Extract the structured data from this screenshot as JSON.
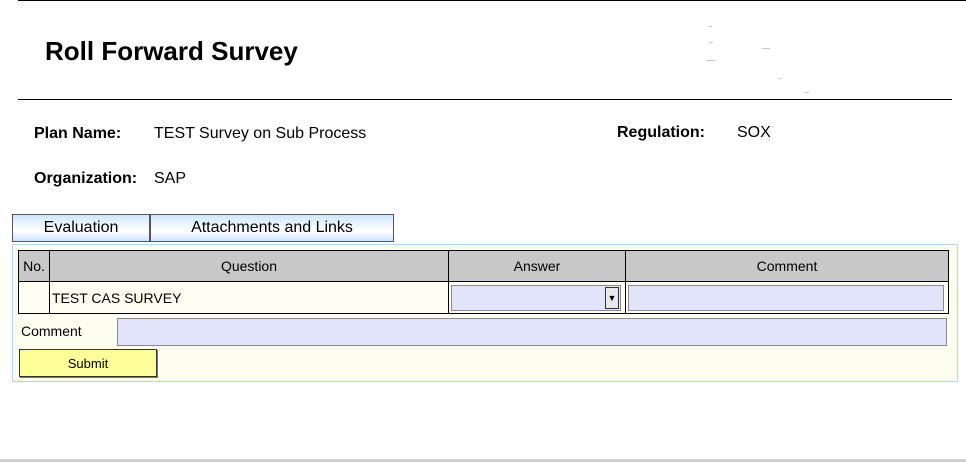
{
  "page": {
    "title": "Roll Forward Survey"
  },
  "fields": {
    "plan_name_label": "Plan Name:",
    "plan_name_value": "TEST Survey on Sub Process",
    "regulation_label": "Regulation:",
    "regulation_value": "SOX",
    "organization_label": "Organization:",
    "organization_value": "SAP"
  },
  "tabs": [
    {
      "label": "Evaluation"
    },
    {
      "label": "Attachments and Links"
    }
  ],
  "table": {
    "headers": [
      "No.",
      "Question",
      "Answer",
      "Comment"
    ],
    "rows": [
      {
        "no": "",
        "question": "TEST CAS SURVEY",
        "answer": "",
        "comment": ""
      }
    ]
  },
  "form": {
    "comment_label": "Comment",
    "comment_value": "",
    "submit_label": "Submit"
  },
  "colors": {
    "tab_gradient": "#cfe6ff",
    "panel_bg": "#fdfdf0",
    "input_bg": "#e1e4fb",
    "header_bg": "#c8c8c8",
    "submit_bg": "#ffff99"
  }
}
